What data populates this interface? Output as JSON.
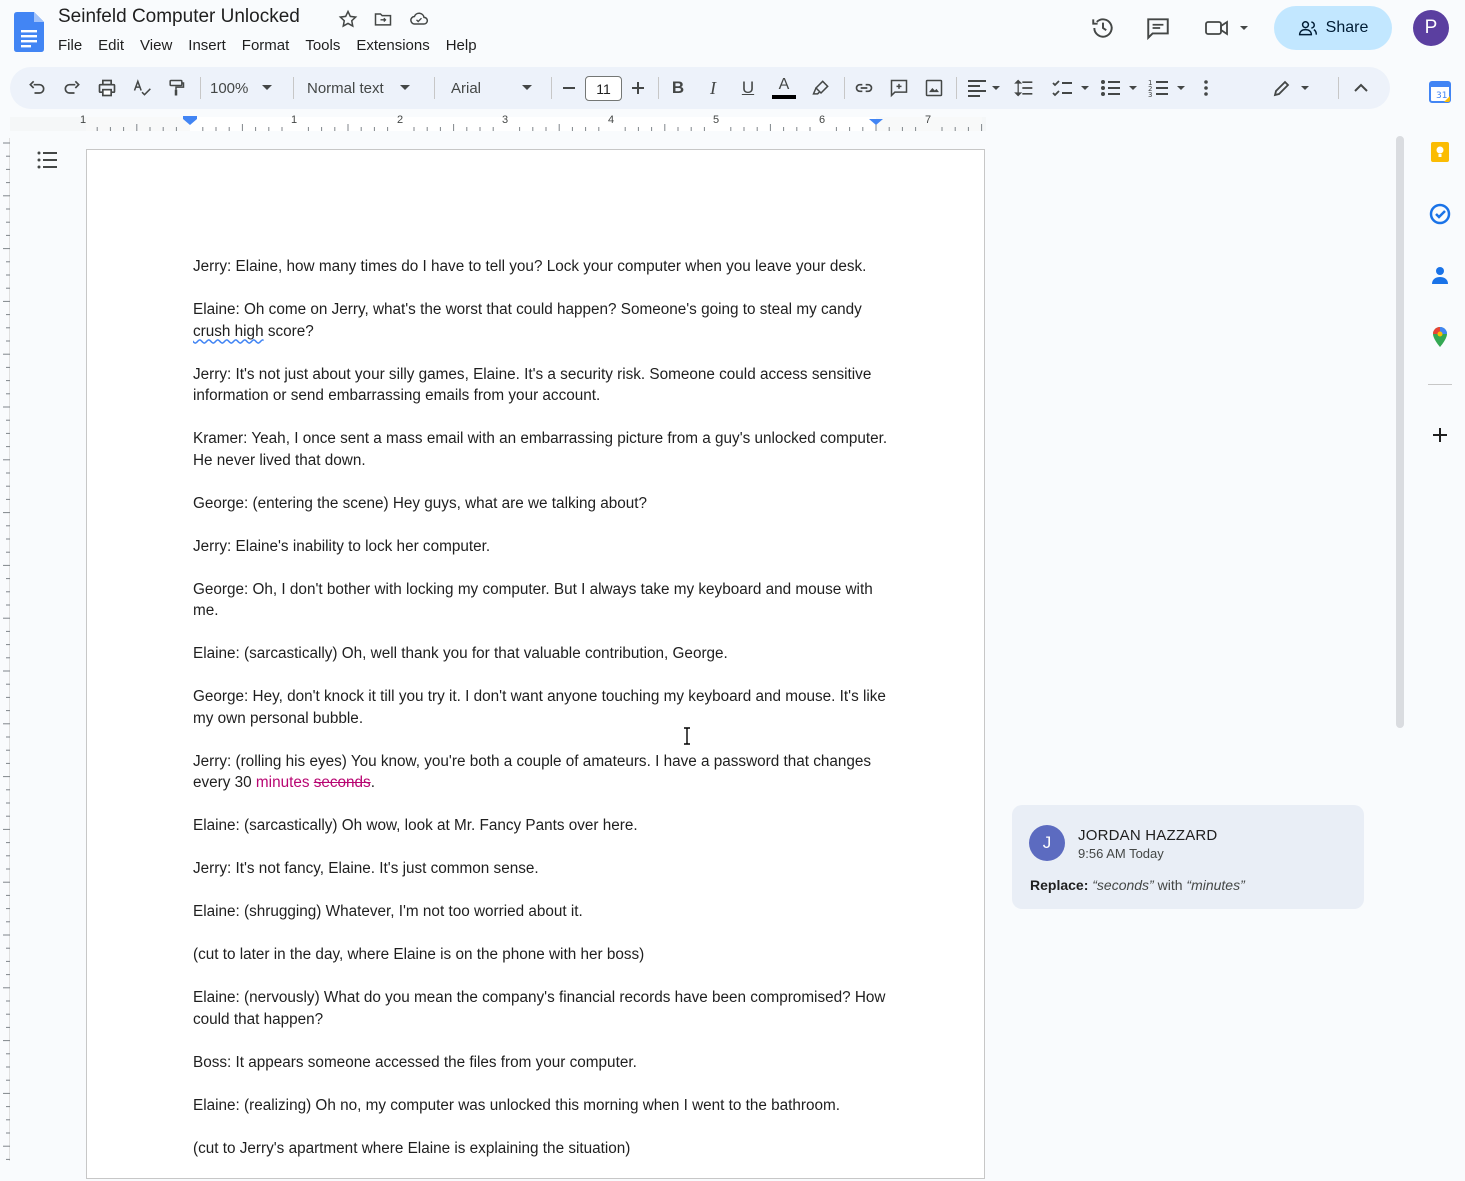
{
  "app": {
    "doc_title": "Seinfeld Computer Unlocked",
    "menus": [
      "File",
      "Edit",
      "View",
      "Insert",
      "Format",
      "Tools",
      "Extensions",
      "Help"
    ],
    "share_label": "Share",
    "user_initial": "P"
  },
  "toolbar": {
    "zoom": "100%",
    "style": "Normal text",
    "font": "Arial",
    "font_size": "11"
  },
  "ruler": {
    "labels": [
      "1",
      "1",
      "2",
      "3",
      "4",
      "5",
      "6",
      "7"
    ]
  },
  "document": {
    "paragraphs": [
      "Jerry: Elaine, how many times do I have to tell you? Lock your computer when you leave your desk.",
      "ELAINE_P",
      "Jerry: It's not just about your silly games, Elaine. It's a security risk. Someone could access sensitive information or send embarrassing emails from your account.",
      "Kramer: Yeah, I once sent a mass email with an embarrassing picture from a guy's unlocked computer. He never lived that down.",
      "George: (entering the scene) Hey guys, what are we talking about?",
      "Jerry: Elaine's inability to lock her computer.",
      "George: Oh, I don't bother with locking my computer. But I always take my keyboard and mouse with me.",
      "Elaine: (sarcastically) Oh, well thank you for that valuable contribution, George.",
      "George: Hey, don't knock it till you try it. I don't want anyone touching my keyboard and mouse. It's like my own personal bubble.",
      "SUGGEST_P",
      "Elaine: (sarcastically) Oh wow, look at Mr. Fancy Pants over here.",
      "Jerry: It's not fancy, Elaine. It's just common sense.",
      "Elaine: (shrugging) Whatever, I'm not too worried about it.",
      "(cut to later in the day, where Elaine is on the phone with her boss)",
      "Elaine: (nervously) What do you mean the company's financial records have been compromised? How could that happen?",
      "Boss: It appears someone accessed the files from your computer.",
      "Elaine: (realizing) Oh no, my computer was unlocked this morning when I went to the bathroom.",
      "(cut to Jerry's apartment where Elaine is explaining the situation)"
    ],
    "elaine_p": {
      "before": "Elaine: Oh come on Jerry, what's the worst that could happen? Someone's going to steal my candy ",
      "squiggle": "crush high",
      "after": " score?"
    },
    "suggest_p": {
      "before": "Jerry: (rolling his eyes) You know, you're both a couple of amateurs. I have a password that changes every 30 ",
      "inserted": "minutes",
      "space": " ",
      "deleted": "seconds",
      "after": "."
    }
  },
  "comment": {
    "initial": "J",
    "author": "JORDAN HAZZARD",
    "time": "9:56 AM Today",
    "action": "Replace:",
    "old": "“seconds”",
    "with": " with ",
    "new": "“minutes”"
  },
  "colors": {
    "suggestion": "#b80672",
    "share_bg": "#c2e7ff",
    "toolbar_bg": "#edf2fa",
    "comment_bg": "#e9eef6",
    "avatar_p": "#5b3fa0",
    "avatar_j": "#5c6bc0"
  }
}
